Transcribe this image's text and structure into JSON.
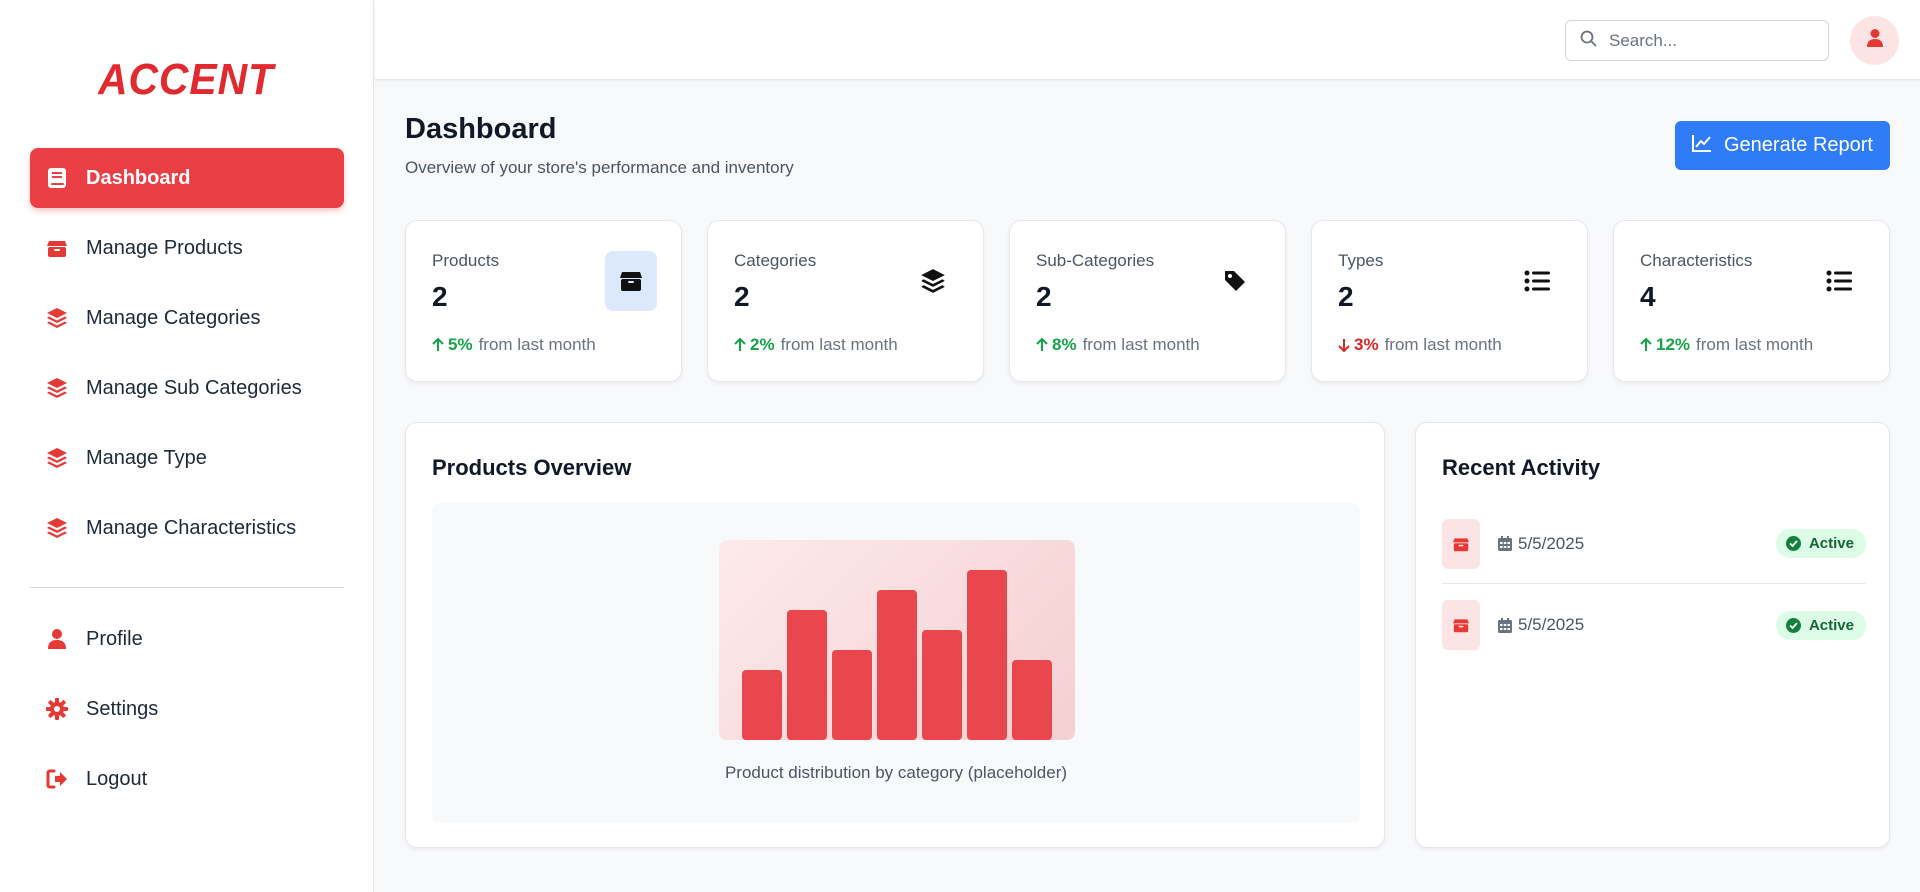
{
  "brand": {
    "logo_text": "ACCENT",
    "accent_color": "#ea3f45",
    "primary_color": "#2f7cf6"
  },
  "sidebar": {
    "items": [
      {
        "label": "Dashboard",
        "icon": "book-icon",
        "active": true
      },
      {
        "label": "Manage Products",
        "icon": "box-icon"
      },
      {
        "label": "Manage Categories",
        "icon": "layers-icon"
      },
      {
        "label": "Manage Sub Categories",
        "icon": "layers-icon"
      },
      {
        "label": "Manage Type",
        "icon": "layers-icon"
      },
      {
        "label": "Manage Characteristics",
        "icon": "layers-icon"
      }
    ],
    "bottom_items": [
      {
        "label": "Profile",
        "icon": "user-icon"
      },
      {
        "label": "Settings",
        "icon": "gear-icon"
      },
      {
        "label": "Logout",
        "icon": "logout-icon"
      }
    ]
  },
  "topbar": {
    "search_placeholder": "Search...",
    "avatar_icon": "user-icon"
  },
  "header": {
    "title": "Dashboard",
    "subtitle": "Overview of your store's performance and inventory",
    "generate_button": "Generate Report"
  },
  "stats": [
    {
      "label": "Products",
      "value": "2",
      "change": "5%",
      "direction": "up",
      "suffix": "from last month",
      "icon": "box-icon"
    },
    {
      "label": "Categories",
      "value": "2",
      "change": "2%",
      "direction": "up",
      "suffix": "from last month",
      "icon": "layers-icon"
    },
    {
      "label": "Sub-Categories",
      "value": "2",
      "change": "8%",
      "direction": "up",
      "suffix": "from last month",
      "icon": "tag-icon"
    },
    {
      "label": "Types",
      "value": "2",
      "change": "3%",
      "direction": "down",
      "suffix": "from last month",
      "icon": "list-icon"
    },
    {
      "label": "Characteristics",
      "value": "4",
      "change": "12%",
      "direction": "up",
      "suffix": "from last month",
      "icon": "list-icon"
    }
  ],
  "overview": {
    "title": "Products Overview",
    "caption": "Product distribution by category (placeholder)"
  },
  "chart_data": {
    "type": "bar",
    "categories": [
      "",
      "",
      "",
      "",
      "",
      "",
      ""
    ],
    "values": [
      35,
      65,
      45,
      75,
      55,
      85,
      40
    ],
    "title": "",
    "xlabel": "",
    "ylabel": "",
    "ylim": [
      0,
      100
    ]
  },
  "activity": {
    "title": "Recent Activity",
    "items": [
      {
        "date": "5/5/2025",
        "status": "Active",
        "icon": "box-icon"
      },
      {
        "date": "5/5/2025",
        "status": "Active",
        "icon": "box-icon"
      }
    ]
  }
}
